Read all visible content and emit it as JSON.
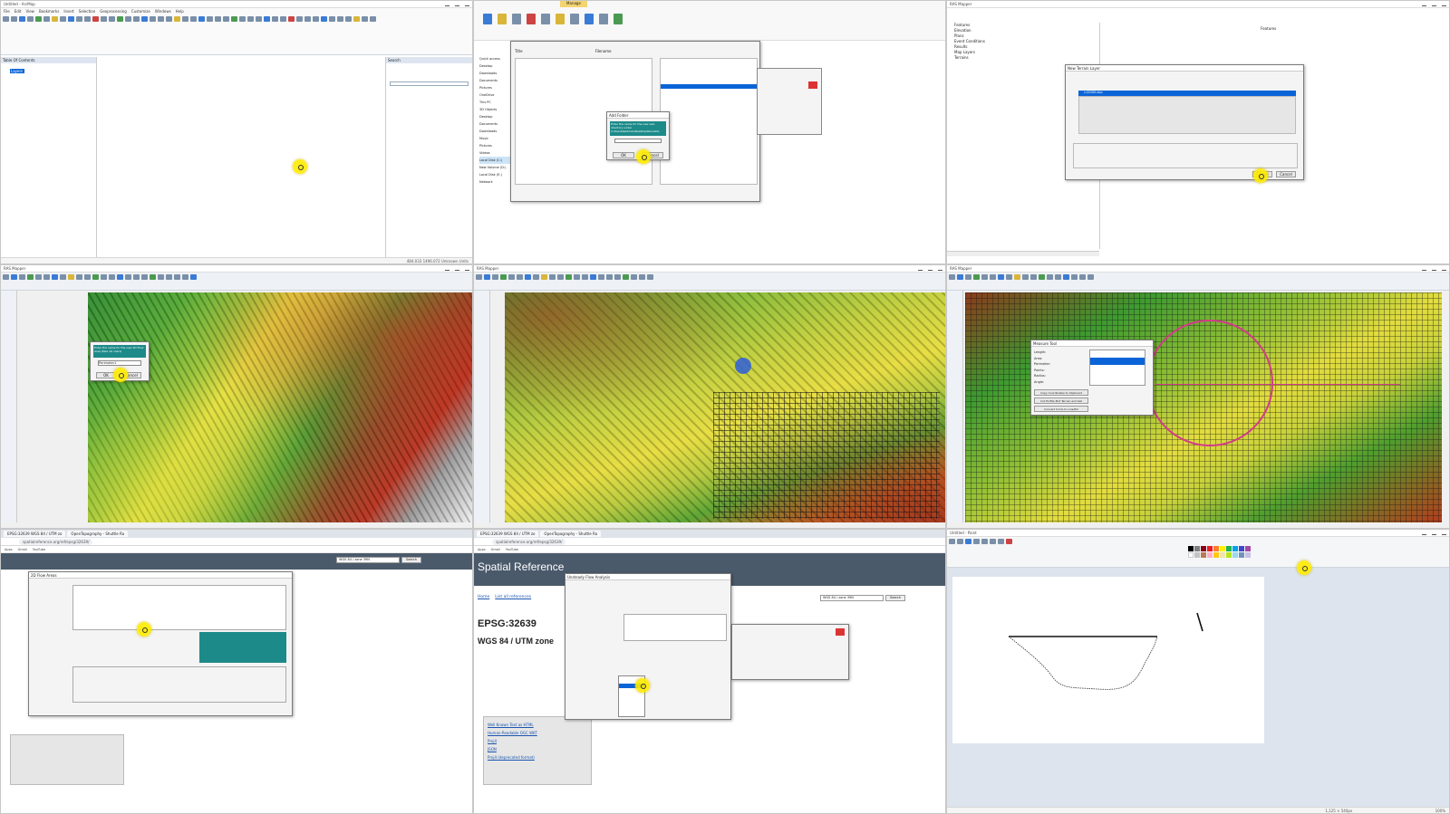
{
  "arcmap": {
    "title": "Untitled - ArcMap",
    "menu": [
      "File",
      "Edit",
      "View",
      "Bookmarks",
      "Insert",
      "Selection",
      "Geoprocessing",
      "Customize",
      "Windows",
      "Help"
    ],
    "toc_title": "Table Of Contents",
    "toc_layer": "Layers",
    "search_title": "Search",
    "status_coords": "484.033  1496.072 Unknown Units"
  },
  "explorer": {
    "ribbon_tab": "Manage",
    "folders": [
      "Quick access",
      "Desktop",
      "Downloads",
      "Documents",
      "Pictures",
      "OneDrive",
      "This PC",
      "3D Objects",
      "Desktop",
      "Documents",
      "Downloads",
      "Music",
      "Pictures",
      "Videos",
      "Local Disk (C:)",
      "New Volume (D:)",
      "Local Disk (E:)",
      "Network"
    ],
    "dialog_title": "Add Folder",
    "dialog_text": "Enter the name for the new sub-directory under C:\\Users\\Sadman\\Desktop\\Novel2e\\",
    "ok": "OK",
    "cancel": "Cancel",
    "cols": [
      "Title",
      "Filename"
    ]
  },
  "terrain": {
    "dialog_title": "New Terrain Layer",
    "row_text": "c:\\0000.shp",
    "create": "Create",
    "cancel": "Cancel",
    "tree": [
      "Features",
      "Elevation",
      "Plans",
      "Event Conditions",
      "Results",
      "Map Layers",
      "Terrains"
    ],
    "header": "Features"
  },
  "ras1": {
    "title": "RAS Mapper",
    "dialog_text": "Enter the name for the new 2D Flow Area (Max 16 chars)",
    "input": "Perimeter1",
    "ok": "OK",
    "cancel": "Cancel"
  },
  "ras3": {
    "dialog_title": "Measure Tool",
    "labels": [
      "Length:",
      "Area:",
      "Perimeter:",
      "Points:",
      "Radius:",
      "Angle:"
    ],
    "btn1": "Copy Coordinates to Clipboard",
    "btn2": "Cut Profile Plot Terrain and Sat",
    "btn3": "Convert Circle to Line/Pol"
  },
  "browser1": {
    "tab1": "EPSG:32639 WGS 84 / UTM zo",
    "tab2": "OpenTopography - Shuttle Ra",
    "url": "spatialreference.org/ref/epsg/32639/",
    "dialog_title": "2D Flow Areas",
    "search_box": "WGS 84 / zone 39N",
    "search_btn": "Search"
  },
  "browser2": {
    "tab1": "EPSG:32639 WGS 84 / UTM zo",
    "tab2": "OpenTopography - Shuttle Ra",
    "url": "spatialreference.org/ref/epsg/32639/",
    "site_title": "Spatial Reference",
    "nav": [
      "Home",
      "List all references"
    ],
    "epsg": "EPSG:32639",
    "subtitle": "WGS 84 / UTM zone",
    "search_box": "WGS 84 / zone 39N",
    "search_btn": "Search",
    "dialog_title": "Unsteady Flow Analysis",
    "links": [
      "Well Known Text as HTML",
      "Human-Readable OGC WKT",
      "Proj4",
      "JSON",
      "Proj4 (deprecated format)"
    ]
  },
  "paint": {
    "title": "Untitled - Paint",
    "status_size": "1,125 × 540px",
    "zoom": "100%"
  },
  "colors": {
    "accent": "#0a64d8",
    "cursor": "#ffeb00",
    "flow_circle": "#d33b8a"
  }
}
